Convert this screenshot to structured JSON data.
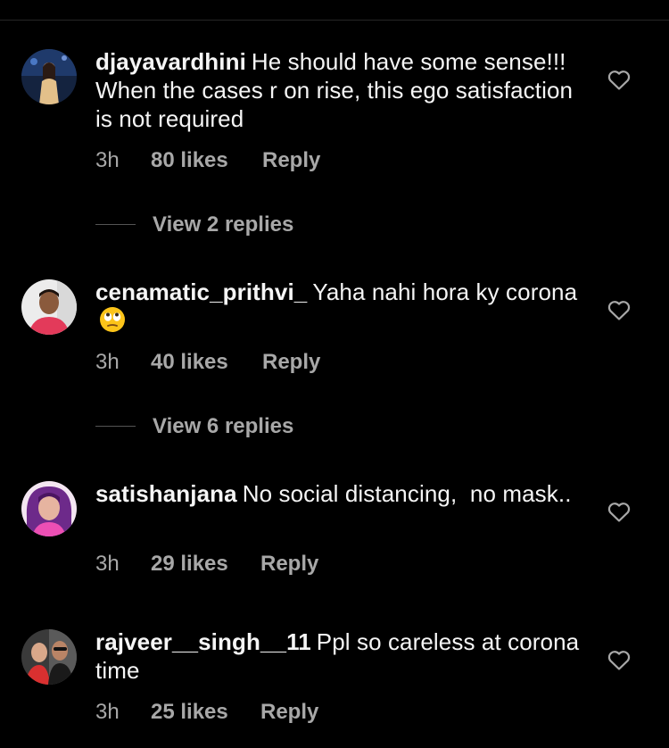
{
  "colors": {
    "background": "#000000",
    "text_primary": "#f5f5f5",
    "text_secondary": "#a8a8a8"
  },
  "comments": [
    {
      "username": "djayavardhini",
      "text": "He should have some sense!!! When the cases r on rise, this ego satisfaction is not required",
      "time": "3h",
      "likes": "80 likes",
      "reply": "Reply",
      "view_replies": "View 2 replies",
      "avatar": "profile-photo",
      "like_icon": "heart-outline-icon"
    },
    {
      "username": "cenamatic_prithvi_",
      "text": "Yaha nahi hora ky corona",
      "emoji": "face-with-rolling-eyes-emoji",
      "time": "3h",
      "likes": "40 likes",
      "reply": "Reply",
      "view_replies": "View 6 replies",
      "avatar": "profile-photo",
      "like_icon": "heart-outline-icon"
    },
    {
      "username": "satishanjana",
      "text": "No social distancing,  no mask..",
      "time": "3h",
      "likes": "29 likes",
      "reply": "Reply",
      "avatar": "profile-photo",
      "like_icon": "heart-outline-icon"
    },
    {
      "username": "rajveer__singh__11",
      "text": "Ppl so careless at corona time",
      "time": "3h",
      "likes": "25 likes",
      "reply": "Reply",
      "avatar": "profile-photo",
      "like_icon": "heart-outline-icon"
    }
  ]
}
